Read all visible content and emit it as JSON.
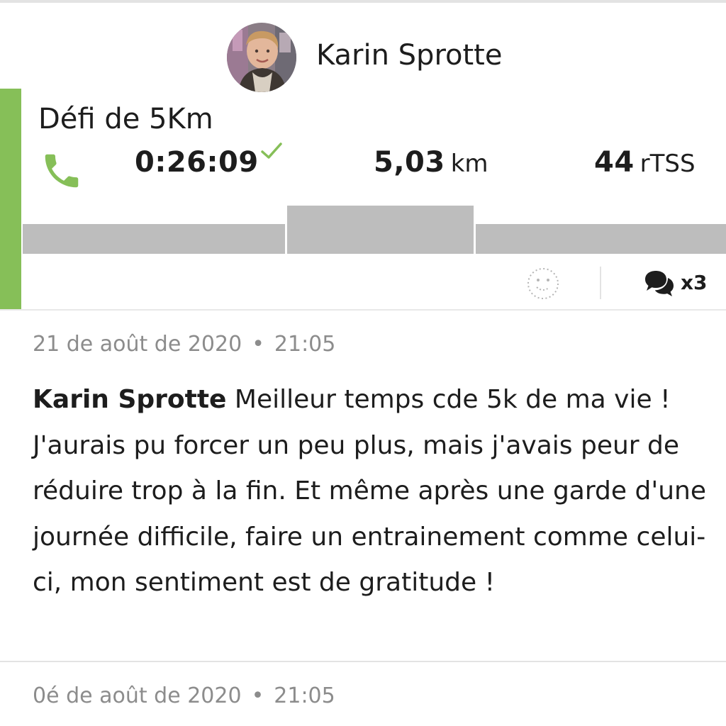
{
  "workout": {
    "athlete_name": "Karin Sprotte",
    "title": "Défi de 5Km",
    "metrics": {
      "duration": "0:26:09",
      "distance_value": "5,03",
      "distance_unit": "km",
      "tss_value": "44",
      "tss_unit": "rTSS"
    },
    "comment_count": "x3",
    "accent_color": "#86bf58"
  },
  "comments": [
    {
      "date": "21 de août de 2020",
      "separator": "•",
      "time": "21:05",
      "author": "Karin Sprotte",
      "text": "Meilleur temps cde 5k de ma vie ! J'aurais pu forcer un peu plus, mais j'avais peur de réduire trop à la fin. Et même après une garde d'une journée difficile, faire un entrainement comme celui-ci, mon sentiment est de gratitude !"
    },
    {
      "date": "0é de août de 2020",
      "separator": "•",
      "time": "21:05"
    }
  ],
  "icons": {
    "sport": "phone-icon",
    "completed": "checkmark-icon",
    "reaction": "smiley-icon",
    "comments": "comment-bubbles-icon"
  }
}
